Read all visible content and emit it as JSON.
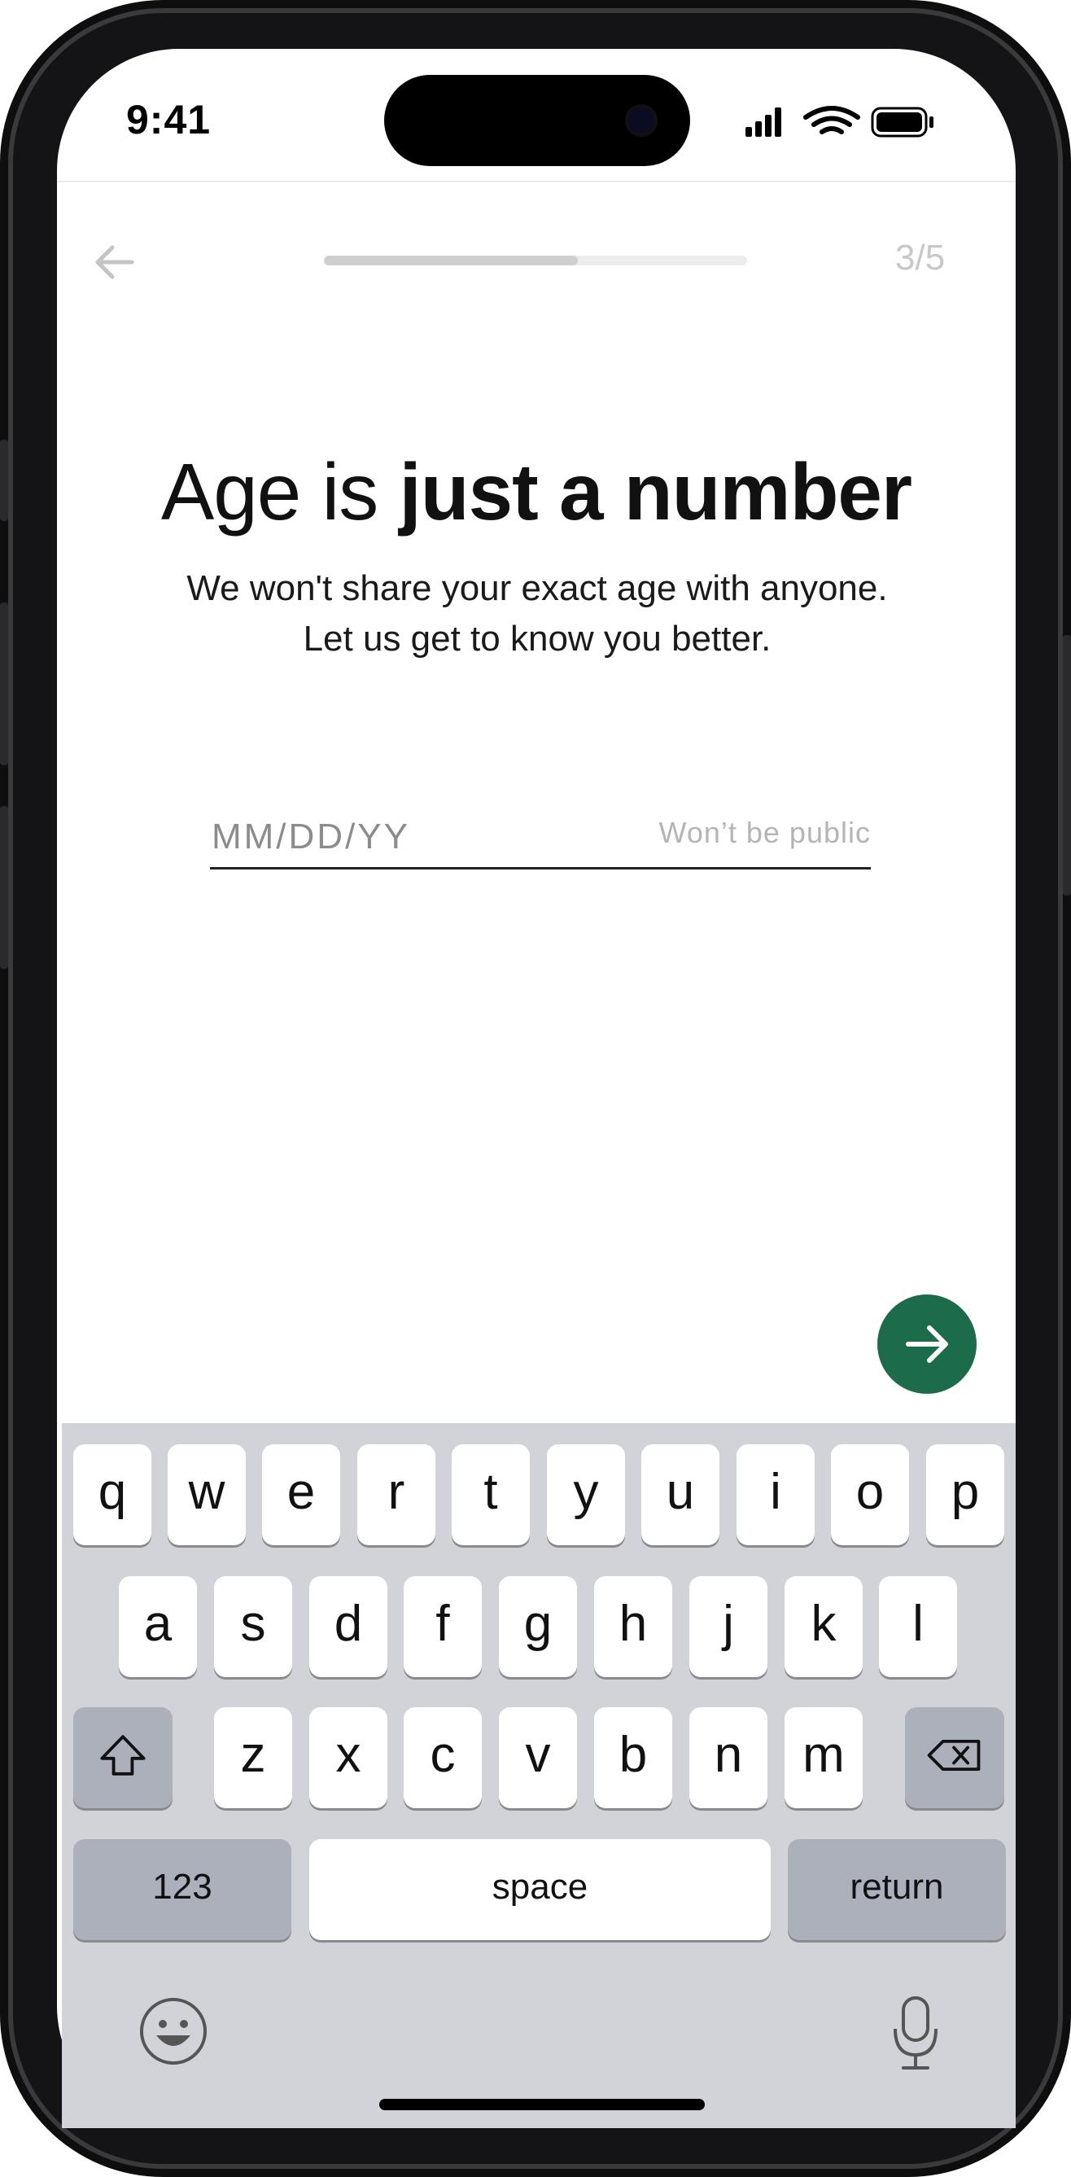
{
  "status_bar": {
    "time": "9:41"
  },
  "nav": {
    "step": "3/5",
    "progress": 0.6
  },
  "heading": {
    "light": "Age is ",
    "bold": "just a number"
  },
  "subtitle": {
    "line1": "We won't share your exact age with anyone.",
    "line2": "Let us get to know you better."
  },
  "dob_field": {
    "placeholder": "MM/DD/YY",
    "value": "",
    "hint": "Won’t be public"
  },
  "colors": {
    "accent": "#1c6b4a",
    "keyboard_bg": "#d1d3d9",
    "modifier_key": "#acb0bb"
  },
  "keyboard": {
    "row1": [
      "q",
      "w",
      "e",
      "r",
      "t",
      "y",
      "u",
      "i",
      "o",
      "p"
    ],
    "row2": [
      "a",
      "s",
      "d",
      "f",
      "g",
      "h",
      "j",
      "k",
      "l"
    ],
    "row3": [
      "z",
      "x",
      "c",
      "v",
      "b",
      "n",
      "m"
    ],
    "numbers_label": "123",
    "space_label": "space",
    "return_label": "return"
  }
}
